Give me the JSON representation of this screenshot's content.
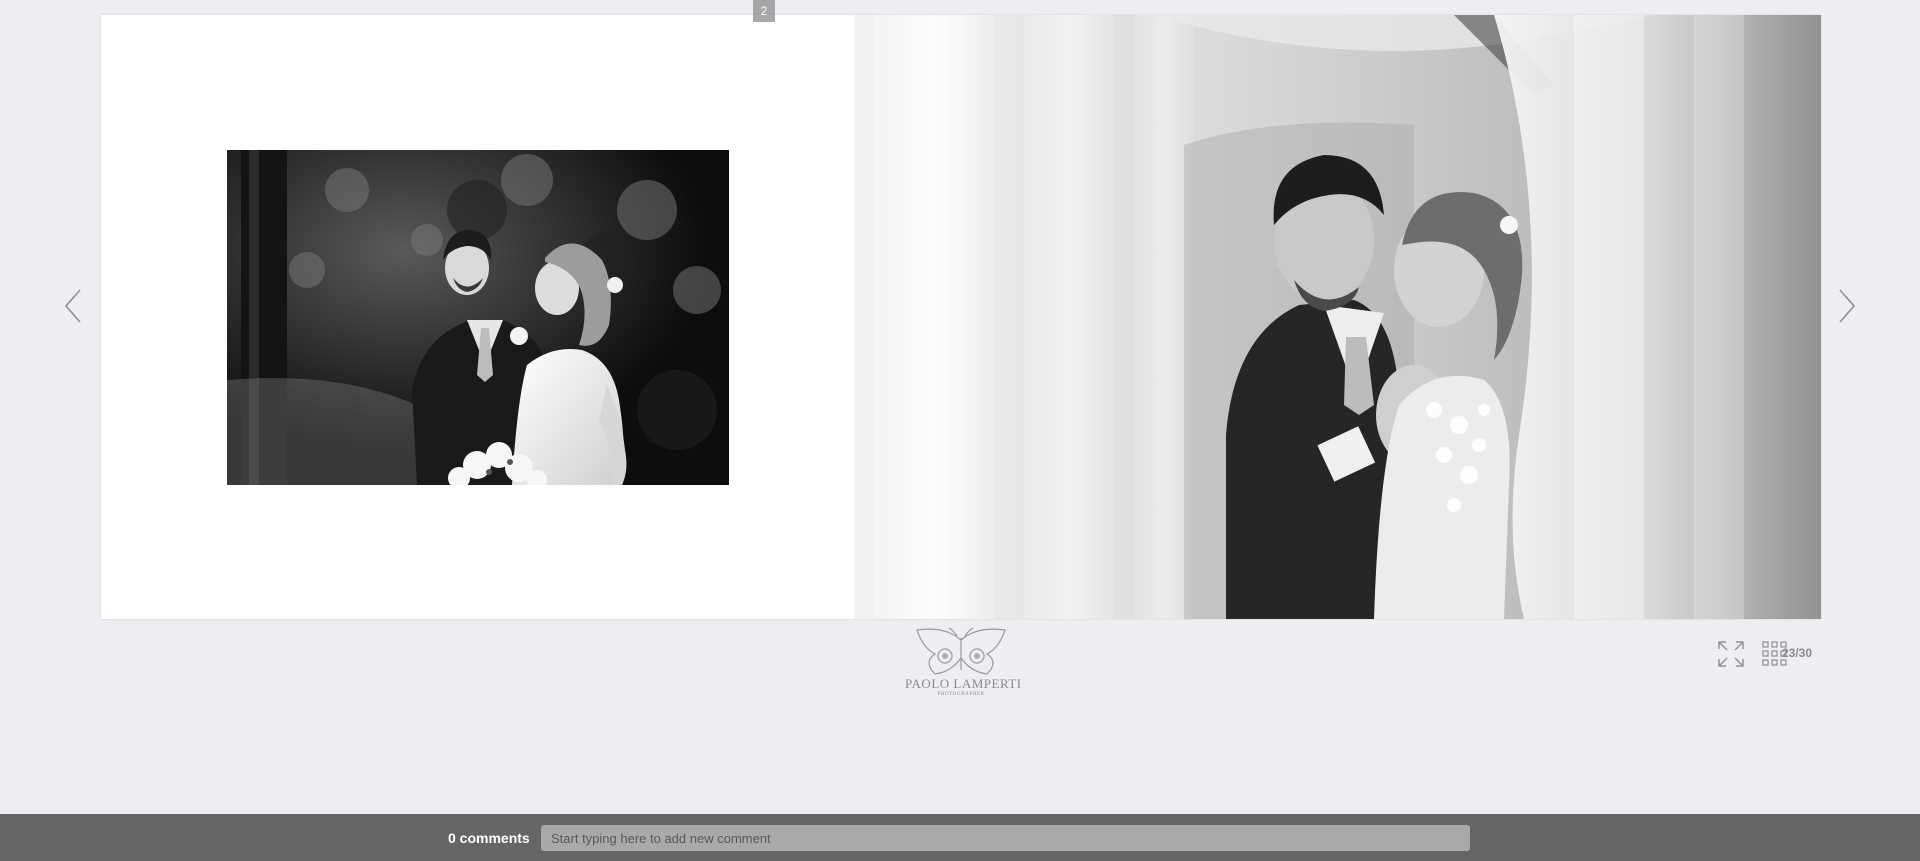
{
  "album": {
    "left_page_photo": "couple-in-forest-photo",
    "right_page_photo": "couple-embrace-curtain-photo",
    "page_number_label": "2",
    "counter": "23/30"
  },
  "navigation": {
    "prev_icon": "chevron-left-icon",
    "next_icon": "chevron-right-icon"
  },
  "logo": {
    "name": "PAOLO LAMPERTI",
    "subtitle": "PHOTOGRAPHER",
    "icon": "butterfly-icon"
  },
  "toolbar": {
    "fullscreen_icon": "fullscreen-icon",
    "grid_icon": "grid-icon"
  },
  "comments": {
    "count_label": "0 comments",
    "placeholder": "Start typing here to add new comment"
  },
  "colors": {
    "background": "#eeeef2",
    "comment_bar": "#666666",
    "comment_input": "#a9a9a9"
  }
}
